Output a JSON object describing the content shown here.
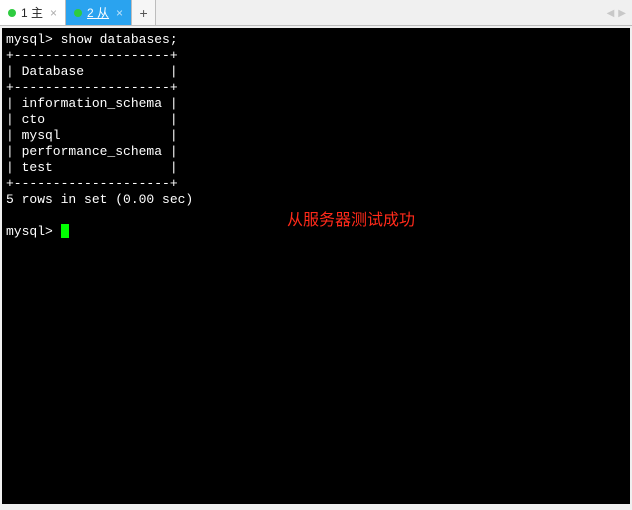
{
  "tabs": {
    "items": [
      {
        "label": "1 主",
        "active": false
      },
      {
        "label": "2 从",
        "active": true
      }
    ],
    "new_tab_glyph": "+",
    "arrow_left": "◀",
    "arrow_right": "▶"
  },
  "terminal": {
    "prompt": "mysql>",
    "command": "show databases;",
    "table": {
      "border_top": "+--------------------+",
      "header_row": "| Database           |",
      "border_mid": "+--------------------+",
      "rows": [
        "| information_schema |",
        "| cto                |",
        "| mysql              |",
        "| performance_schema |",
        "| test               |"
      ],
      "border_bottom": "+--------------------+"
    },
    "status": "5 rows in set (0.00 sec)",
    "prompt2": "mysql>"
  },
  "annotation": "从服务器测试成功"
}
